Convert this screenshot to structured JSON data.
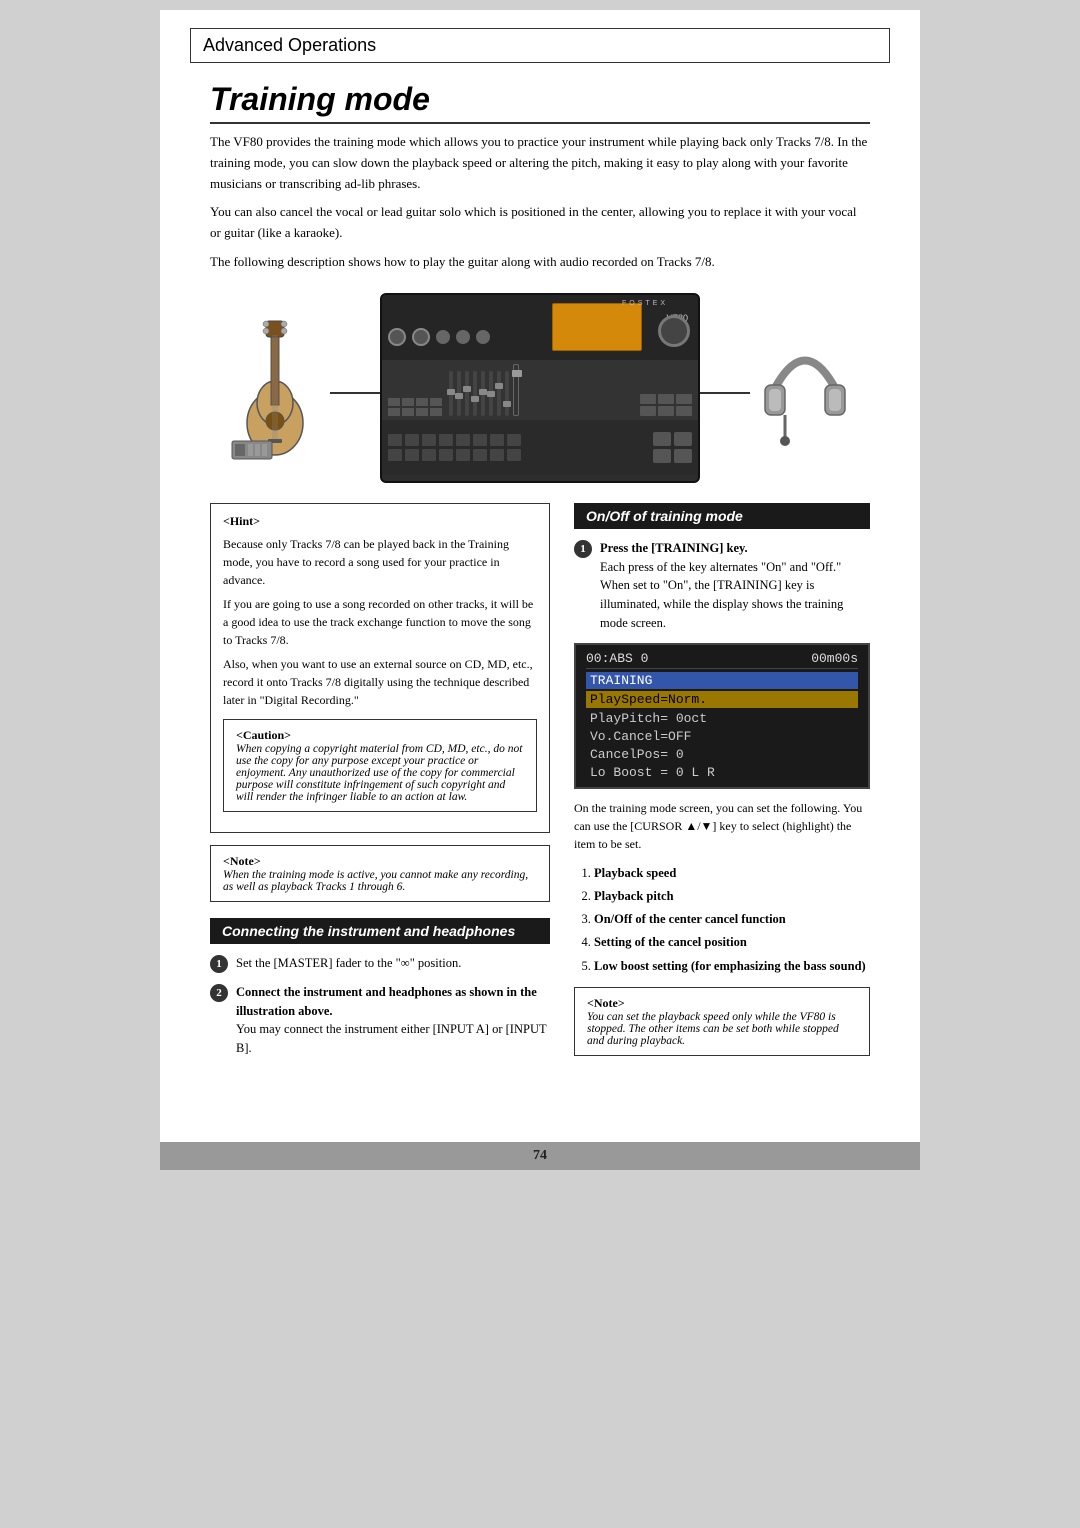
{
  "header": {
    "title": "Advanced Operations"
  },
  "section": {
    "title": "Training mode"
  },
  "intro": {
    "para1": "The VF80 provides the training mode which allows you to practice your instrument while playing back only Tracks 7/8.  In the training mode, you can slow down the playback speed or altering the pitch, making it easy to play along with your favorite musicians or transcribing ad-lib phrases.",
    "para2": "You can also cancel the vocal or lead guitar solo which is positioned in the center, allowing you to replace it with your vocal or guitar (like a karaoke).",
    "para3": "The following description shows how to play the guitar along with audio recorded on Tracks 7/8."
  },
  "hint": {
    "title": "<Hint>",
    "text1": "Because only Tracks 7/8 can be played back in the Training mode, you have to record a song used for your practice in advance.",
    "text2": "If you are going to use a song recorded on other tracks, it will be a good idea to use the track exchange function to move the song to Tracks 7/8.",
    "text3": "Also, when you want to use an external source on CD, MD, etc., record it onto Tracks 7/8 digitally using the technique described later in \"Digital Recording.\""
  },
  "caution": {
    "title": "<Caution>",
    "text": "When copying a copyright material from CD, MD, etc., do not use the copy for any purpose except your practice or enjoyment.  Any unauthorized use of the copy for commercial purpose will constitute infringement of such copyright and will render the infringer liable to an action at law."
  },
  "note_left": {
    "title": "<Note>",
    "text": "When the training mode is active, you cannot make any recording, as well as playback Tracks 1 through 6."
  },
  "connecting": {
    "header": "Connecting the instrument and headphones",
    "step1_num": "1",
    "step1_text": "Set the [MASTER] fader to the \"∞\" position.",
    "step2_num": "2",
    "step2_text_bold": "Connect the instrument and headphones as shown in the illustration above.",
    "step2_sub": "You may connect the instrument either [INPUT A] or [INPUT B]."
  },
  "on_off": {
    "header": "On/Off of training mode",
    "step1_num": "1",
    "step1_bold": "Press the [TRAINING] key.",
    "step1_text1": "Each press of the key alternates \"On\" and \"Off.\"",
    "step1_text2": "When set to \"On\", the [TRAINING] key is illuminated, while the display shows the training mode screen."
  },
  "display": {
    "row1_left": "00:ABS 0",
    "row1_right": "00m00s",
    "row2": "TRAINING",
    "row3": "PlaySpeed=Norm.",
    "row4": "PlayPitch= 0oct",
    "row5": "Vo.Cancel=OFF",
    "row6": "CancelPos=    0",
    "row7": "Lo Boost =    0  L R"
  },
  "training_desc": "On the training mode screen, you can set the following. You can use the [CURSOR ▲/▼] key to select (highlight) the item to be set.",
  "items_list": [
    "Playback speed",
    "Playback pitch",
    "On/Off of the center cancel function",
    "Setting of the cancel position",
    "Low boost setting (for emphasizing the bass sound)"
  ],
  "note_right": {
    "title": "<Note>",
    "text": "You can set the playback speed only while the VF80 is stopped. The other items can be set both while stopped and during playback."
  },
  "footer": {
    "page_num": "74"
  }
}
